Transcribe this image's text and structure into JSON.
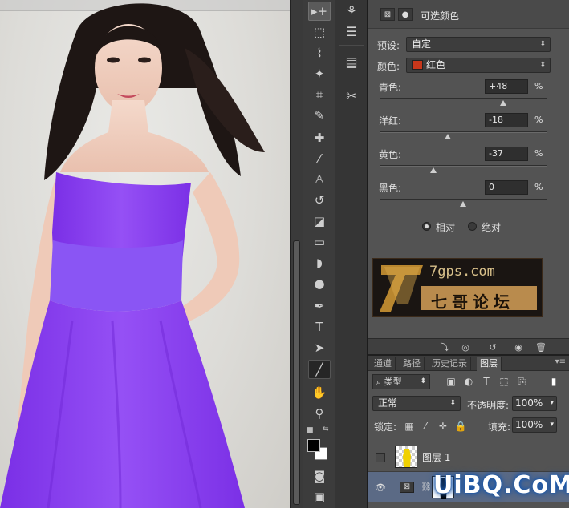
{
  "toolbox": {
    "tools": [
      {
        "name": "move-tool-icon",
        "glyph": "▸+"
      },
      {
        "name": "marquee-tool-icon",
        "glyph": "⬚"
      },
      {
        "name": "lasso-tool-icon",
        "glyph": "⌇"
      },
      {
        "name": "magic-wand-tool-icon",
        "glyph": "✦"
      },
      {
        "name": "crop-tool-icon",
        "glyph": "⌗"
      },
      {
        "name": "eyedropper-tool-icon",
        "glyph": "✎"
      },
      {
        "name": "healing-brush-tool-icon",
        "glyph": "✚"
      },
      {
        "name": "brush-tool-icon",
        "glyph": "⁄"
      },
      {
        "name": "clone-stamp-tool-icon",
        "glyph": "♙"
      },
      {
        "name": "history-brush-tool-icon",
        "glyph": "↺"
      },
      {
        "name": "eraser-tool-icon",
        "glyph": "◪"
      },
      {
        "name": "gradient-tool-icon",
        "glyph": "▭"
      },
      {
        "name": "blur-tool-icon",
        "glyph": "◗"
      },
      {
        "name": "dodge-tool-icon",
        "glyph": "●"
      },
      {
        "name": "pen-tool-icon",
        "glyph": "✒"
      },
      {
        "name": "type-tool-icon",
        "glyph": "T"
      },
      {
        "name": "path-selection-tool-icon",
        "glyph": "➤"
      },
      {
        "name": "line-tool-icon",
        "glyph": "╱"
      },
      {
        "name": "hand-tool-icon",
        "glyph": "✋"
      },
      {
        "name": "zoom-tool-icon",
        "glyph": "⚲"
      }
    ],
    "quick_mask_icon": "◙",
    "screen_mode_icon": "▣"
  },
  "dock": {
    "icons": [
      "history-panel-icon",
      "adjustments-panel-icon",
      "layer-comps-icon",
      "tools-presets-icon"
    ]
  },
  "properties": {
    "title": "可选颜色",
    "preset_label": "预设:",
    "preset_value": "自定",
    "colors_label": "颜色:",
    "colors_value": "红色",
    "colors_chip": "#c7371b",
    "sliders": [
      {
        "label": "青色:",
        "value": "+48",
        "unit": "%",
        "fraction": 0.74
      },
      {
        "label": "洋红:",
        "value": "-18",
        "unit": "%",
        "fraction": 0.41
      },
      {
        "label": "黄色:",
        "value": "-37",
        "unit": "%",
        "fraction": 0.32
      },
      {
        "label": "黑色:",
        "value": "0",
        "unit": "%",
        "fraction": 0.5
      }
    ],
    "method_relative": "相对",
    "method_absolute": "绝对",
    "method_selected": "relative",
    "watermark_url": "7gps.com",
    "watermark_text": "七哥论坛"
  },
  "layers": {
    "tabs": [
      "通道",
      "路径",
      "历史记录",
      "图层"
    ],
    "active_tab": "图层",
    "filter_label": "类型",
    "blend_mode": "正常",
    "opacity_label": "不透明度:",
    "opacity_value": "100%",
    "lock_label": "锁定:",
    "fill_label": "填充:",
    "fill_value": "100%",
    "items": [
      {
        "name": "图层 1",
        "visible": false,
        "active": false
      },
      {
        "name": "",
        "visible": true,
        "active": true
      }
    ]
  },
  "site_watermark": "UiBQ.CoM",
  "colors": {
    "dress": "#8a3ff0",
    "panel": "#535353",
    "selected_layer": "#5b6a85"
  }
}
